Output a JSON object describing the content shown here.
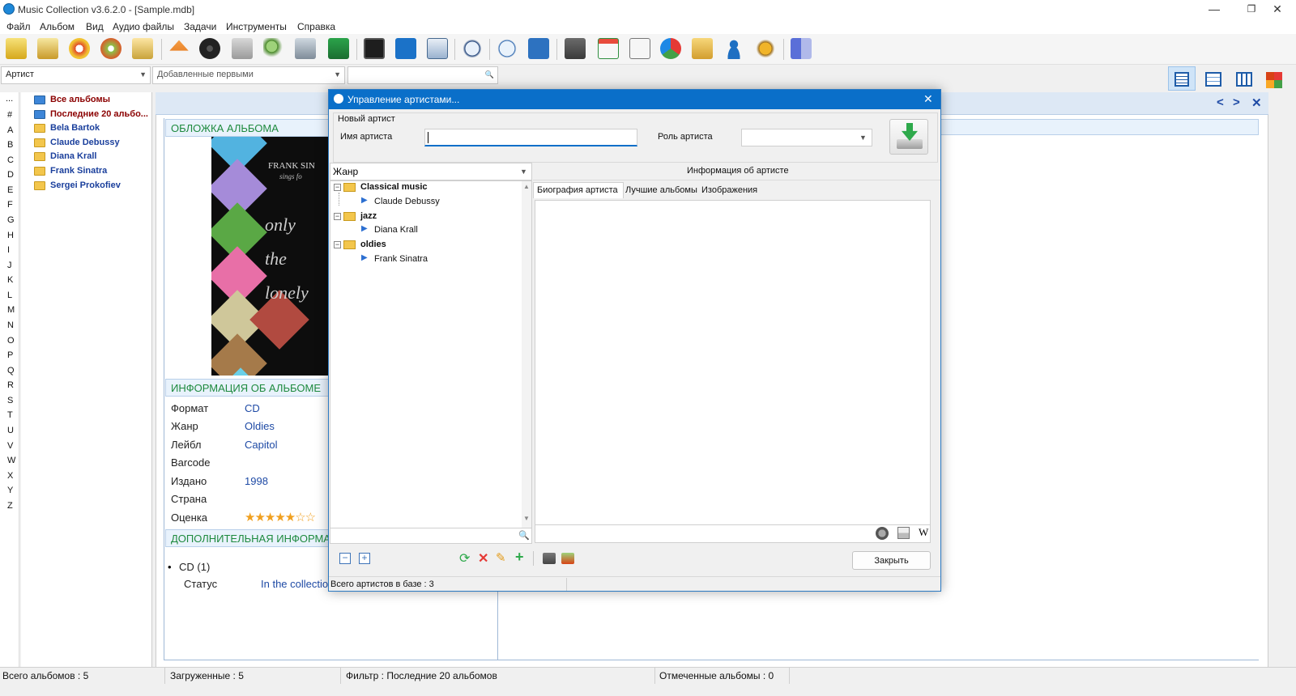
{
  "window": {
    "title": "Music Collection v3.6.2.0 - [Sample.mdb]",
    "minimize": "—",
    "restore": "❐",
    "close": "✕"
  },
  "menu": [
    "Файл",
    "Альбом",
    "Вид",
    "Аудио файлы",
    "Задачи",
    "Инструменты",
    "Справка"
  ],
  "toolbar_icons": [
    "add-album-icon",
    "add-from-disc-icon",
    "disc-lookup-icon",
    "cd-text-icon",
    "search-doc-icon",
    "eject-icon",
    "text-disc-icon",
    "download-icon",
    "zoom-icon",
    "tools-icon",
    "add-image-icon",
    "film-icon",
    "edit-icon",
    "search-magnify-icon",
    "music-search-icon",
    "play-icon",
    "shuffle-icon",
    "print-icon",
    "calendar-icon",
    "document-icon",
    "pie-chart-icon",
    "folder-box-icon",
    "user-icon",
    "settings-icon",
    "exit-icon"
  ],
  "filter": {
    "artist_combo": "Артист",
    "sort_combo": "Добавленные первыми",
    "search_placeholder": ""
  },
  "letters": [
    "...",
    "#",
    "A",
    "B",
    "C",
    "D",
    "E",
    "F",
    "G",
    "H",
    "I",
    "J",
    "K",
    "L",
    "M",
    "N",
    "O",
    "P",
    "Q",
    "R",
    "S",
    "T",
    "U",
    "V",
    "W",
    "X",
    "Y",
    "Z"
  ],
  "tree": [
    {
      "label": "Все альбомы",
      "color": "#8b0000"
    },
    {
      "label": "Последние 20 альбо...",
      "color": "#8b0000"
    },
    {
      "label": "Bela Bartok",
      "color": "#1a3f9c"
    },
    {
      "label": "Claude Debussy",
      "color": "#1a3f9c"
    },
    {
      "label": "Diana Krall",
      "color": "#1a3f9c"
    },
    {
      "label": "Frank Sinatra",
      "color": "#1a3f9c"
    },
    {
      "label": "Sergei Prokofiev",
      "color": "#1a3f9c"
    }
  ],
  "panel_nav": {
    "prev": "<",
    "next": ">",
    "close": "✕"
  },
  "sections": {
    "cover": "ОБЛОЖКА АЛЬБОМА",
    "info": "ИНФОРМАЦИЯ ОБ АЛЬБОМЕ",
    "extra": "ДОПОЛНИТЕЛЬНАЯ ИНФОРМАЦ"
  },
  "cover_text": {
    "brand": "FRANK SIN",
    "sub": "sings fo",
    "script": "only the lonely"
  },
  "album_info": [
    {
      "label": "Формат",
      "value": "CD"
    },
    {
      "label": "Жанр",
      "value": "Oldies"
    },
    {
      "label": "Лейбл",
      "value": "Capitol"
    },
    {
      "label": "Barcode",
      "value": ""
    },
    {
      "label": "Издано",
      "value": "1998"
    },
    {
      "label": "Страна",
      "value": ""
    },
    {
      "label": "Оценка",
      "value": "★★★★★☆☆"
    }
  ],
  "extra_info": {
    "bullet": "CD (1)",
    "status_label": "Статус",
    "status_value": "In the collectio"
  },
  "dialog": {
    "title": "Управление артистами...",
    "close": "✕",
    "group_label": "Новый артист",
    "name_label": "Имя артиста",
    "name_value": "",
    "role_label": "Роль артиста",
    "role_value": "",
    "genre_combo": "Жанр",
    "info_header": "Информация об артисте",
    "tabs": [
      "Биография артиста",
      "Лучшие альбомы",
      "Изображения"
    ],
    "genres": [
      {
        "genre": "Classical music",
        "artists": [
          "Claude Debussy"
        ]
      },
      {
        "genre": "jazz",
        "artists": [
          "Diana Krall"
        ]
      },
      {
        "genre": "oldies",
        "artists": [
          "Frank Sinatra"
        ]
      }
    ],
    "close_button": "Закрыть",
    "status": "Всего артистов в базе : 3",
    "wiki_glyph": "W"
  },
  "statusbar": {
    "total": "Всего альбомов : 5",
    "loaded": "Загруженные : 5",
    "filter": "Фильтр : Последние 20 альбомов",
    "marked": "Отмеченные альбомы : 0"
  },
  "colors": {
    "accent": "#0a6fc9",
    "section_text": "#1e8a3e",
    "link": "#1e4aa5"
  }
}
